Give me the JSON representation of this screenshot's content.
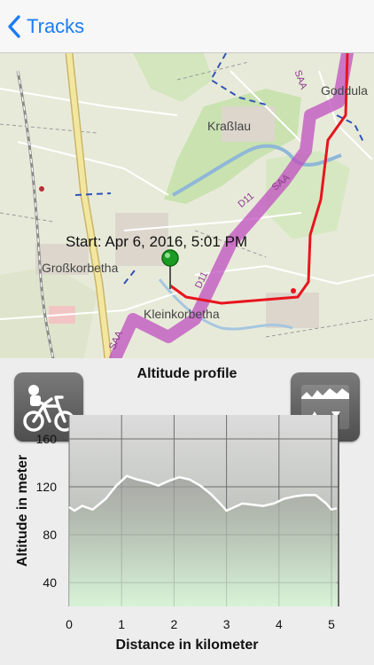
{
  "nav": {
    "back_label": "Tracks",
    "back_icon": "chevron-left-icon",
    "accent": "#1a7cf5"
  },
  "map": {
    "places": [
      "Goddula",
      "Kraßlau",
      "Großkorbetha",
      "Kleinkorbetha"
    ],
    "route_labels": [
      "SAA",
      "D11",
      "SAA",
      "D11",
      "SAA"
    ],
    "start_label": "Start: Apr 6, 2016, 5:01 PM",
    "track_color": "#e8141e",
    "route_color": "#c04fc0"
  },
  "profile": {
    "title": "Altitude profile",
    "activity_icon": "bicycle-icon",
    "scale_icon": "vertical-scale-icon"
  },
  "chart_data": {
    "type": "line",
    "title": "",
    "xlabel": "Distance in kilometer",
    "ylabel": "Altitude in meter",
    "xlim": [
      0,
      5.1
    ],
    "ylim": [
      20,
      180
    ],
    "xticks": [
      "0",
      "1",
      "2",
      "3",
      "4",
      "5"
    ],
    "yticks": [
      "40",
      "80",
      "120",
      "160"
    ],
    "grid": true,
    "series": [
      {
        "x": [
          0,
          0.1,
          0.25,
          0.45,
          0.7,
          0.9,
          1.1,
          1.3,
          1.5,
          1.7,
          1.9,
          2.1,
          2.3,
          2.5,
          2.7,
          2.9,
          3.0,
          3.1,
          3.3,
          3.5,
          3.7,
          3.9,
          4.1,
          4.3,
          4.5,
          4.7,
          4.9,
          5.0,
          5.1
        ],
        "y": [
          103,
          100,
          104,
          101,
          110,
          121,
          129,
          126,
          124,
          121,
          125,
          128,
          126,
          121,
          114,
          105,
          100,
          102,
          106,
          105,
          104,
          106,
          110,
          112,
          113,
          113,
          106,
          101,
          102
        ]
      }
    ]
  }
}
